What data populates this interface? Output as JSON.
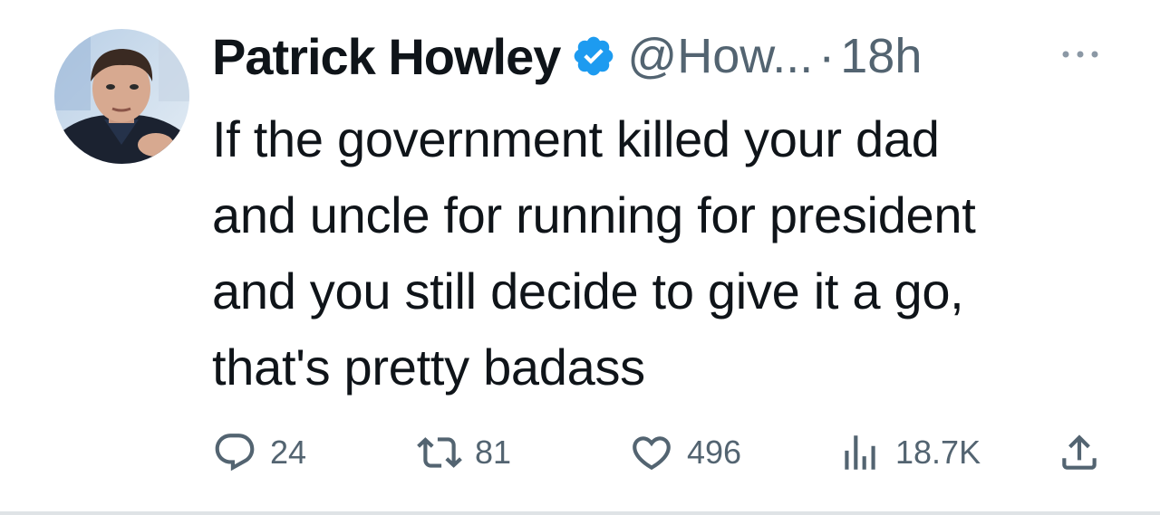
{
  "author": {
    "display_name": "Patrick Howley",
    "handle": "@How...",
    "verified": true,
    "separator": "·",
    "timestamp": "18h"
  },
  "tweet": {
    "text": "If the government killed your dad\nand uncle for running for president\nand you still decide to give it a go,\nthat's pretty badass"
  },
  "actions": {
    "replies": "24",
    "retweets": "81",
    "likes": "496",
    "views": "18.7K"
  },
  "icons": {
    "verified": "verified-badge-icon",
    "more": "more-icon",
    "reply": "reply-icon",
    "retweet": "retweet-icon",
    "like": "heart-icon",
    "views": "views-icon",
    "share": "share-icon"
  },
  "colors": {
    "verified_blue": "#1d9bf0",
    "text_primary": "#0f1419",
    "text_secondary": "#536471"
  }
}
